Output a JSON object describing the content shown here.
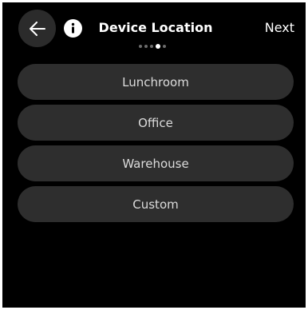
{
  "header": {
    "back_icon": "arrow-left-icon",
    "info_icon": "info-icon",
    "title": "Device Location",
    "next_label": "Next",
    "page_count": 5,
    "current_page": 4
  },
  "options": [
    {
      "label": "Lunchroom"
    },
    {
      "label": "Office"
    },
    {
      "label": "Warehouse"
    },
    {
      "label": "Custom"
    }
  ],
  "colors": {
    "background": "#000000",
    "button_fill": "#2e2e2e",
    "back_button_fill": "#2b2b2b",
    "text": "#ffffff",
    "inactive_dot": "#6b6b6b"
  }
}
